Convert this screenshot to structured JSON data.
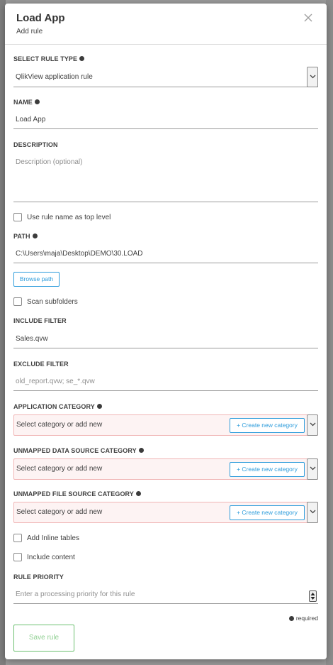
{
  "modal": {
    "title": "Load App",
    "subtitle": "Add rule"
  },
  "rule_type": {
    "label": "SELECT RULE TYPE",
    "value": "QlikView application rule"
  },
  "name": {
    "label": "NAME",
    "value": "Load App"
  },
  "description": {
    "label": "DESCRIPTION",
    "placeholder": "Description (optional)"
  },
  "use_rule_name": {
    "label": "Use rule name as top level"
  },
  "path": {
    "label": "PATH",
    "value": "C:\\Users\\maja\\Desktop\\DEMO\\30.LOAD",
    "browse_label": "Browse path"
  },
  "scan_subfolders": {
    "label": "Scan subfolders"
  },
  "include_filter": {
    "label": "INCLUDE FILTER",
    "value": "Sales.qvw"
  },
  "exclude_filter": {
    "label": "EXCLUDE FILTER",
    "placeholder": "old_report.qvw; se_*.qvw"
  },
  "application_category": {
    "label": "APPLICATION CATEGORY",
    "placeholder": "Select category or add new",
    "create_label": "+ Create new category"
  },
  "unmapped_data_source_category": {
    "label": "UNMAPPED DATA SOURCE CATEGORY",
    "placeholder": "Select category or add new",
    "create_label": "+ Create new category"
  },
  "unmapped_file_source_category": {
    "label": "UNMAPPED FILE SOURCE CATEGORY",
    "placeholder": "Select category or add new",
    "create_label": "+ Create new category"
  },
  "add_inline_tables": {
    "label": "Add Inline tables"
  },
  "include_content": {
    "label": "Include content"
  },
  "rule_priority": {
    "label": "RULE PRIORITY",
    "placeholder": "Enter a processing priority for this rule"
  },
  "required_note": "required",
  "save_label": "Save rule",
  "colors": {
    "accent_blue": "#2d9cdb",
    "save_green": "#6cc070",
    "category_error_bg": "#fdf3f3",
    "category_error_border": "#f0b5b5"
  }
}
